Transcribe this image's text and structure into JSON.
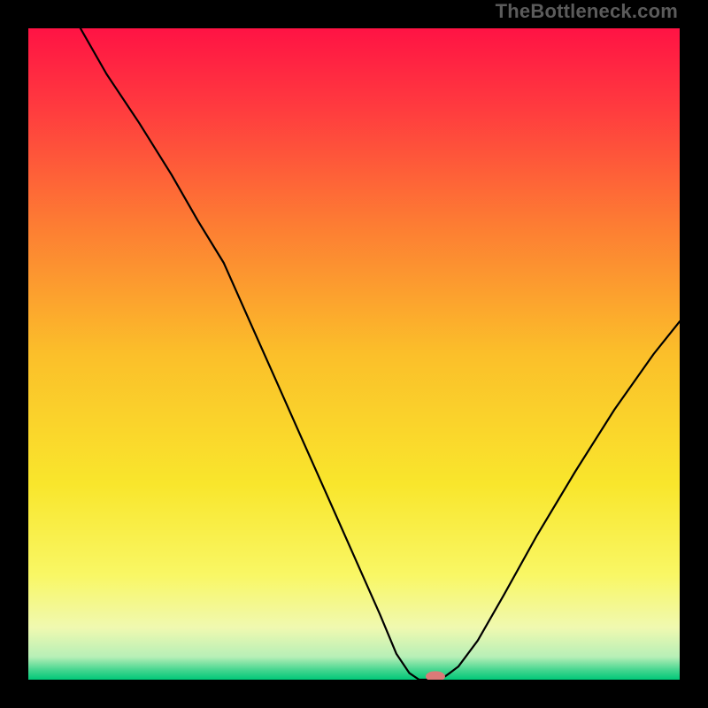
{
  "watermark": "TheBottleneck.com",
  "chart_data": {
    "type": "line",
    "title": "",
    "xlabel": "",
    "ylabel": "",
    "xlim": [
      0,
      100
    ],
    "ylim": [
      0,
      100
    ],
    "grid": false,
    "legend": false,
    "background": {
      "type": "vertical-gradient",
      "stops": [
        {
          "pos": 0.0,
          "color": "#ff1344"
        },
        {
          "pos": 0.12,
          "color": "#ff3a3f"
        },
        {
          "pos": 0.3,
          "color": "#fd7c33"
        },
        {
          "pos": 0.5,
          "color": "#fbbf2a"
        },
        {
          "pos": 0.7,
          "color": "#f9e62c"
        },
        {
          "pos": 0.84,
          "color": "#f9f765"
        },
        {
          "pos": 0.92,
          "color": "#f0f9b0"
        },
        {
          "pos": 0.965,
          "color": "#b7efb7"
        },
        {
          "pos": 0.985,
          "color": "#46d690"
        },
        {
          "pos": 1.0,
          "color": "#00c878"
        }
      ]
    },
    "series": [
      {
        "name": "bottleneck-curve",
        "color": "#000000",
        "width": 2.2,
        "x": [
          8,
          12,
          17,
          22,
          26,
          30,
          34,
          38,
          42,
          46,
          50,
          54,
          56.5,
          58.5,
          60,
          62,
          64,
          66,
          69,
          73,
          78,
          84,
          90,
          96,
          100
        ],
        "y": [
          100,
          93,
          85.5,
          77.5,
          70.5,
          64,
          55,
          46,
          37,
          28,
          19,
          10,
          4,
          1,
          0,
          0,
          0.5,
          2,
          6,
          13,
          22,
          32,
          41.5,
          50,
          55
        ]
      }
    ],
    "marker": {
      "name": "optimal-marker",
      "x": 62.5,
      "y": 0.5,
      "color": "#db7a78",
      "rx": 11,
      "ry": 6
    }
  }
}
